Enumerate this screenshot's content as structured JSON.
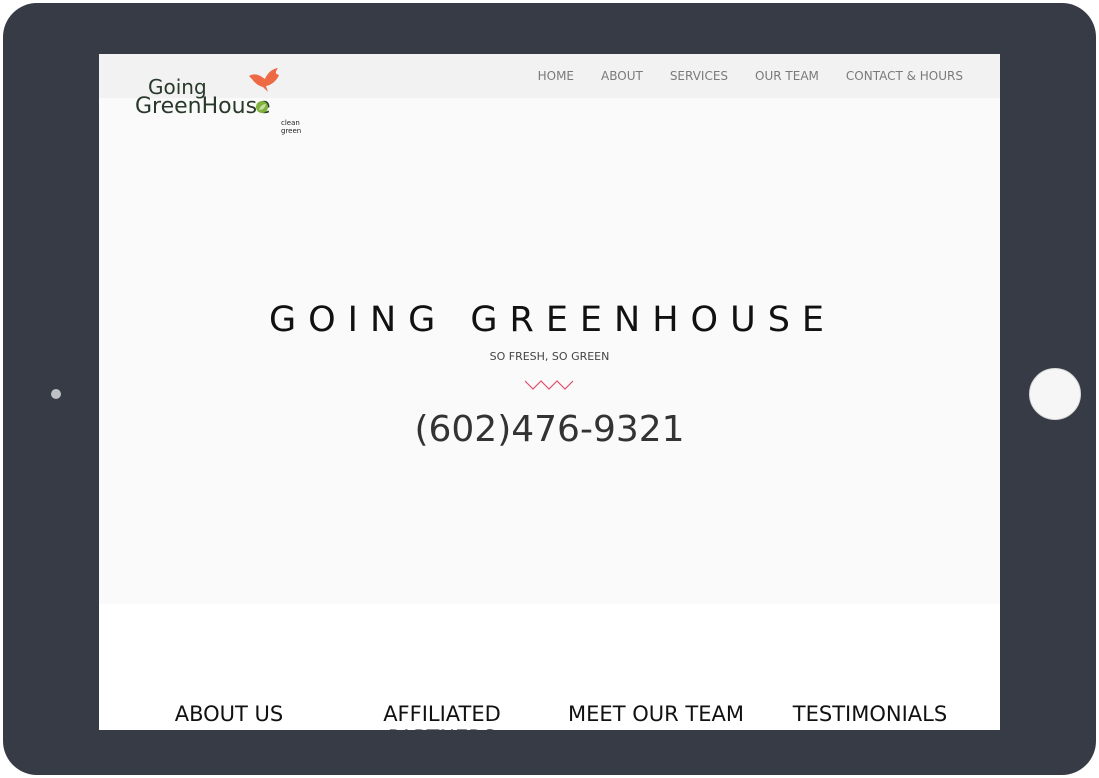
{
  "logo": {
    "line1": "Going",
    "line2": "GreenHouse",
    "tagline": "clean green"
  },
  "nav": {
    "items": [
      {
        "label": "HOME"
      },
      {
        "label": "ABOUT"
      },
      {
        "label": "SERVICES"
      },
      {
        "label": "OUR TEAM"
      },
      {
        "label": "CONTACT & HOURS"
      }
    ]
  },
  "hero": {
    "title": "GOING GREENHOUSE",
    "subtitle": "SO FRESH, SO GREEN",
    "phone": "(602)476-9321"
  },
  "sections": [
    {
      "label": "ABOUT US"
    },
    {
      "label": "AFFILIATED PARTNERS"
    },
    {
      "label": "MEET OUR TEAM"
    },
    {
      "label": "TESTIMONIALS"
    }
  ],
  "colors": {
    "device_frame": "#373b46",
    "zigzag_accent": "#e0506e",
    "bird_accent": "#ee6a44",
    "leaf_accent": "#7fb23a"
  }
}
